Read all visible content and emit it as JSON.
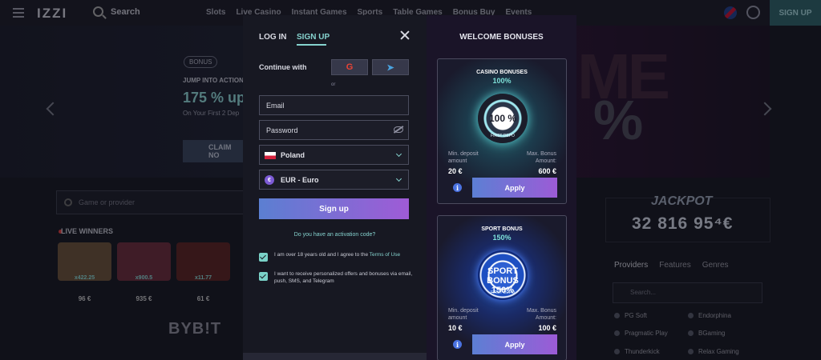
{
  "header": {
    "logo": "IZZI",
    "search_label": "Search",
    "nav": [
      "Slots",
      "Live Casino",
      "Instant Games",
      "Sports",
      "Table Games",
      "Bonus Buy",
      "Events"
    ],
    "signup_label": "SIGN UP"
  },
  "banner": {
    "tag": "BONUS",
    "subtitle": "JUMP INTO ACTION",
    "headline": "175 % up",
    "small": "On Your First 2 Dep",
    "claim": "CLAIM NO"
  },
  "games": {
    "search_placeholder": "Game or provider",
    "live_winners": "LIVE WINNERS",
    "tiles": [
      {
        "tag": "x422.25",
        "amount": "96 €",
        "color": "#6a5038"
      },
      {
        "tag": "x900.5",
        "amount": "935 €",
        "color": "#6a2a3a"
      },
      {
        "tag": "x11.77",
        "amount": "61 €",
        "color": "#5a2220"
      }
    ],
    "partner": "BYB!T"
  },
  "sidebar": {
    "jackpot_title": "JACKPOT",
    "jackpot_amount": "32 816 95⁴€",
    "tabs": [
      "Providers",
      "Features",
      "Genres"
    ],
    "search_placeholder": "Search...",
    "providers": [
      "PG Soft",
      "Endorphina",
      "Pragmatic Play",
      "BGaming",
      "Thunderkick",
      "Relax Gaming"
    ]
  },
  "auth": {
    "tab_login": "LOG IN",
    "tab_signup": "SIGN UP",
    "continue_with": "Continue with",
    "google": "G",
    "telegram": "➤",
    "or": "or",
    "email_placeholder": "Email",
    "password_placeholder": "Password",
    "country": "Poland",
    "currency": "EUR - Euro",
    "currency_symbol": "€",
    "signup_button": "Sign up",
    "activation": "Do you have an activation code?",
    "age_text": "I am over 18 years old and I agree to the",
    "terms_link": "Terms of Use",
    "marketing_text": "I want to receive personalized offers and bonuses via email, push, SMS, and Telegram"
  },
  "bonuses": {
    "heading": "WELCOME BONUSES",
    "cards": [
      {
        "title": "CASINO BONUSES",
        "percent": "100%",
        "chip_text": "100 %",
        "chip_sub": "FIRST DEPO",
        "min_label": "Min. deposit amount",
        "min_value": "20 €",
        "max_label": "Max. Bonus Amount:",
        "max_value": "600 €",
        "apply": "Apply"
      },
      {
        "title": "SPORT BONUS",
        "percent": "150%",
        "chip_text": "SPORT BONUS 150%",
        "chip_sub": "FIRST DEPO",
        "min_label": "Min. deposit amount",
        "min_value": "10 €",
        "max_label": "Max. Bonus Amount:",
        "max_value": "100 €",
        "apply": "Apply"
      }
    ]
  }
}
